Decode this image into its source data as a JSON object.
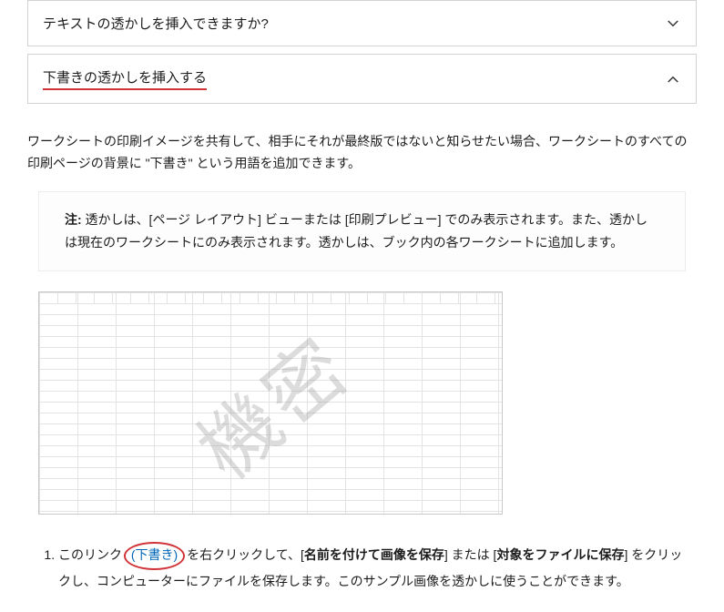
{
  "accordion": {
    "collapsed": {
      "title": "テキストの透かしを挿入できますか?"
    },
    "expanded": {
      "title": "下書きの透かしを挿入する"
    }
  },
  "intro": "ワークシートの印刷イメージを共有して、相手にそれが最終版ではないと知らせたい場合、ワークシートのすべての印刷ページの背景に \"下書き\" という用語を追加できます。",
  "note": {
    "label": "注:",
    "text": " 透かしは、[ページ レイアウト] ビューまたは [印刷プレビュー] でのみ表示されます。また、透かしは現在のワークシートにのみ表示されます。透かしは、ブック内の各ワークシートに追加します。"
  },
  "watermark_sample_text": "機密",
  "step1": {
    "prefix": "このリンク ",
    "link_text": "(下書き)",
    "mid1": " を右クリックして、[",
    "bold1": "名前を付けて画像を保存",
    "mid2": "] または [",
    "bold2": "対象をファイルに保存",
    "suffix": "] をクリックし、コンピューターにファイルを保存します。このサンプル画像を透かしに使うことができます。"
  }
}
